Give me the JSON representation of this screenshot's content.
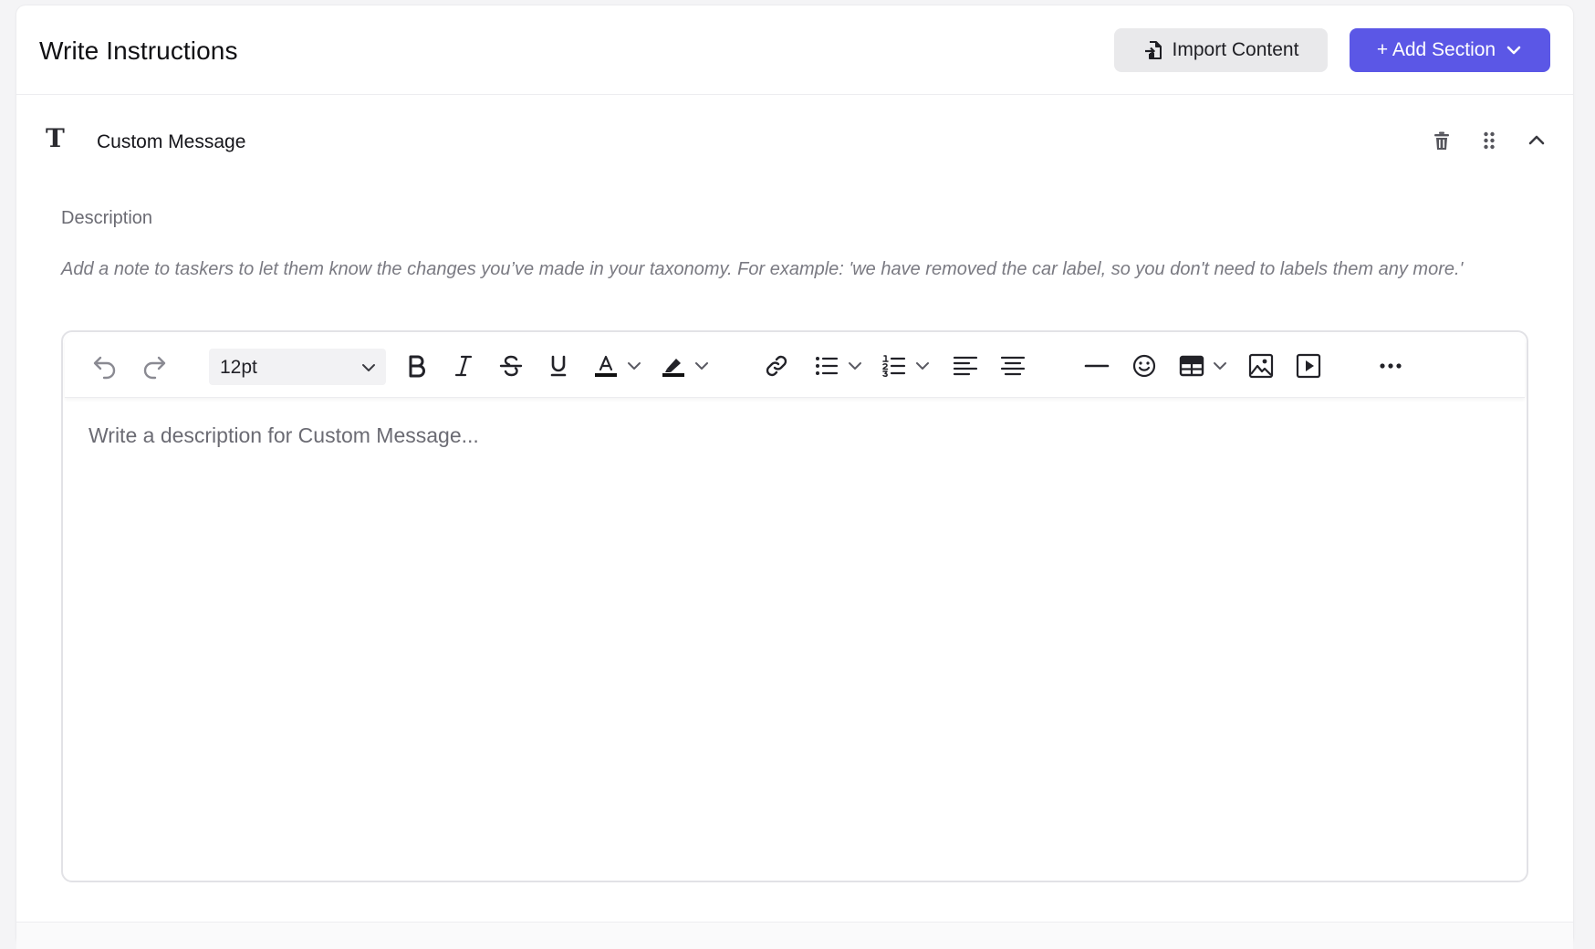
{
  "header": {
    "title": "Write Instructions",
    "import_label": "Import Content",
    "add_section_label": "+ Add Section"
  },
  "section": {
    "type_icon": "T",
    "title": "Custom Message",
    "description_label": "Description",
    "description_help": "Add a note to taskers to let them know the changes you’ve made in your taxonomy. For example: 'we have removed the car label, so you don't need to labels them any more.'"
  },
  "editor": {
    "font_size": "12pt",
    "placeholder": "Write a description for Custom Message...",
    "text_color": "#111111",
    "highlight_color": "#111111"
  },
  "colors": {
    "accent": "#5b57e6",
    "secondary_button": "#e9e9eb"
  },
  "icons": {
    "import": "file-import-icon",
    "chevron_down": "chevron-down-icon",
    "delete": "trash-icon",
    "drag": "drag-handle-icon",
    "collapse": "chevron-up-icon"
  }
}
